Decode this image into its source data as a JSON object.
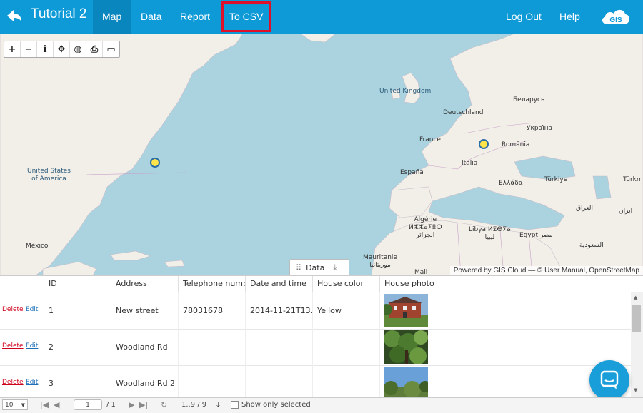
{
  "header": {
    "title": "Tutorial 2",
    "nav": [
      "Map",
      "Data",
      "Report",
      "To CSV"
    ],
    "logout": "Log Out",
    "help": "Help",
    "logo_text": "GIS"
  },
  "map": {
    "labels": {
      "uk": "United Kingdom",
      "de": "Deutschland",
      "by": "Беларусь",
      "ua": "Україна",
      "fr": "France",
      "ro": "România",
      "us": "United States\nof America",
      "es": "España",
      "it": "Italia",
      "tr": "Türkiye",
      "gr": "Ελλάδα",
      "tr2": "Türkm",
      "iq": "العراق",
      "ir": "ایران",
      "mx": "México",
      "dz": "Algérie\nⵍⵣⵣⴰⵢⴻⵔ\nالجزائر",
      "ly": "Libya ⵍⵉⴱⵢⴰ\nليبيا",
      "eg": "Egypt مصر",
      "sa": "السعودية",
      "mr": "Mauritanie\nموريتانيا",
      "ml": "Mali"
    },
    "data_tab": "Data",
    "attribution": "Powered by GIS Cloud — © User Manual, OpenStreetMap"
  },
  "grid": {
    "columns": [
      "ID",
      "Address",
      "Telephone numb",
      "Date and time",
      "House color",
      "House photo"
    ],
    "delete_label": "Delete",
    "edit_label": "Edit",
    "rows": [
      {
        "id": "1",
        "address": "New street",
        "phone": "78031678",
        "datetime": "2014-11-21T13..",
        "color": "Yellow"
      },
      {
        "id": "2",
        "address": "Woodland Rd",
        "phone": "",
        "datetime": "",
        "color": ""
      },
      {
        "id": "3",
        "address": "Woodland Rd 2",
        "phone": "",
        "datetime": "",
        "color": ""
      }
    ]
  },
  "pager": {
    "page_size": "10",
    "page_current": "1",
    "page_total": "/ 1",
    "range": "1..9 / 9",
    "show_selected": "Show only selected"
  },
  "colors": {
    "header": "#0e9ad7",
    "water": "#aad3df",
    "land": "#f2efe9",
    "marker_fill": "#ffe44a",
    "marker_stroke": "#2b6ea6",
    "delete_link": "#d0021b",
    "highlight": "#e0102a"
  }
}
